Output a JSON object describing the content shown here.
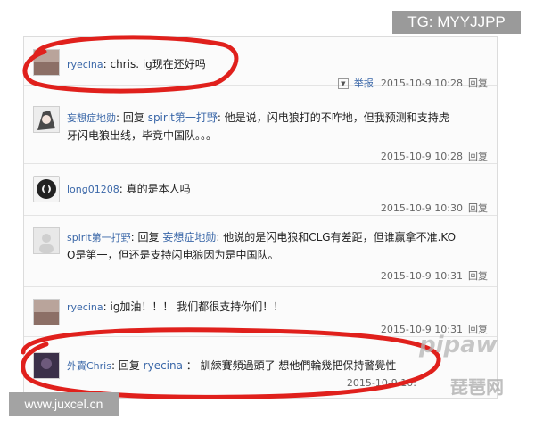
{
  "overlays": {
    "tg_label": "TG: MYYJJPP",
    "site_label": "www.juxcel.cn",
    "watermark_top": "pipaw",
    "watermark_bottom": "琵琶网"
  },
  "comments": [
    {
      "user": "ryecina",
      "text": ": chris. ig现在还好吗",
      "report": "举报",
      "time": "2015-10-9 10:28",
      "reply": "回复"
    },
    {
      "user": "妄想症地勋",
      "prefix": ": 回复 ",
      "mention": "spirit第一打野",
      "text": ": 他是说，闪电狼打的不咋地，但我预测和支持虎",
      "text2": "牙闪电狼出线，毕竟中国队。。。",
      "time": "2015-10-9 10:28",
      "reply": "回复"
    },
    {
      "user": "long01208",
      "text": ": 真的是本人吗",
      "time": "2015-10-9 10:30",
      "reply": "回复"
    },
    {
      "user": "spirit第一打野",
      "prefix": ": 回复 ",
      "mention": "妄想症地勋",
      "text": ": 他说的是闪电狼和CLG有差距，但谁赢拿不准.KO",
      "text2": "O是第一，但还是支持闪电狼因为是中国队。",
      "time": "2015-10-9 10:31",
      "reply": "回复"
    },
    {
      "user": "ryecina",
      "text": ": ig加油！！！ 我们都很支持你们！！",
      "time": "2015-10-9 10:31",
      "reply": "回复"
    },
    {
      "user": "外賣Chris",
      "prefix": ": 回复 ",
      "mention": "ryecina",
      "text": " ： 訓練賽頻過頭了 想他們輪幾把保持警覺性",
      "time": "2015-10-9 10:",
      "reply": ""
    }
  ]
}
